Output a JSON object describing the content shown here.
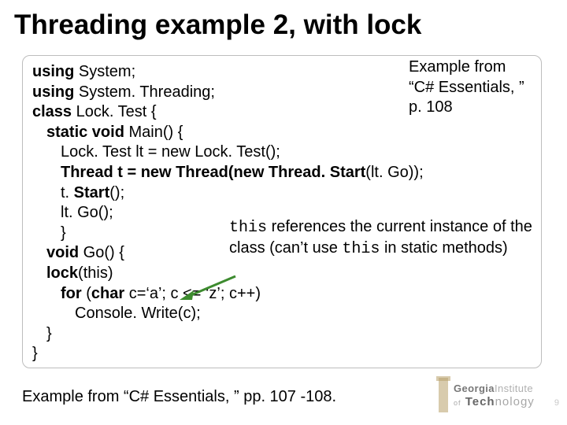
{
  "title": "Threading example 2, with lock",
  "source_note": {
    "l1": "Example from",
    "l2": "“C# Essentials, ”",
    "l3": "p. 108"
  },
  "code": {
    "l01a": "using",
    "l01b": " System;",
    "l02a": "using",
    "l02b": " System. Threading;",
    "l03a": "class",
    "l03b": " Lock. Test {",
    "l04a": "static void",
    "l04b": " Main() {",
    "l05": "Lock. Test lt = new Lock. Test();",
    "l06a": "Thread t = new Thread(new Thread. Start",
    "l06b": "(lt. Go));",
    "l07a": "t. ",
    "l07b": "Start",
    "l07c": "();",
    "l08": "lt. Go();",
    "l09": "}",
    "l10a": "void",
    "l10b": " Go() {",
    "l11a": "lock",
    "l11b": "(this)",
    "l12a": "for",
    "l12b": " (",
    "l12c": "char",
    "l12d": " c=‘a’; c <= ‘z’; c++)",
    "l13": "Console. Write(c);",
    "l14": "}",
    "l15": "}"
  },
  "annotation": {
    "this": "this",
    "after_this": " references the current instance of the class (can’t use ",
    "this2": "this",
    "tail": " in static methods)"
  },
  "footer": "Example from “C# Essentials, ” pp. 107 -108.",
  "logo": {
    "line1a": "Georgia",
    "line1b": "Institute",
    "line2a": "Tech",
    "line2b": "nology",
    "of": "of"
  },
  "page_num": "9"
}
